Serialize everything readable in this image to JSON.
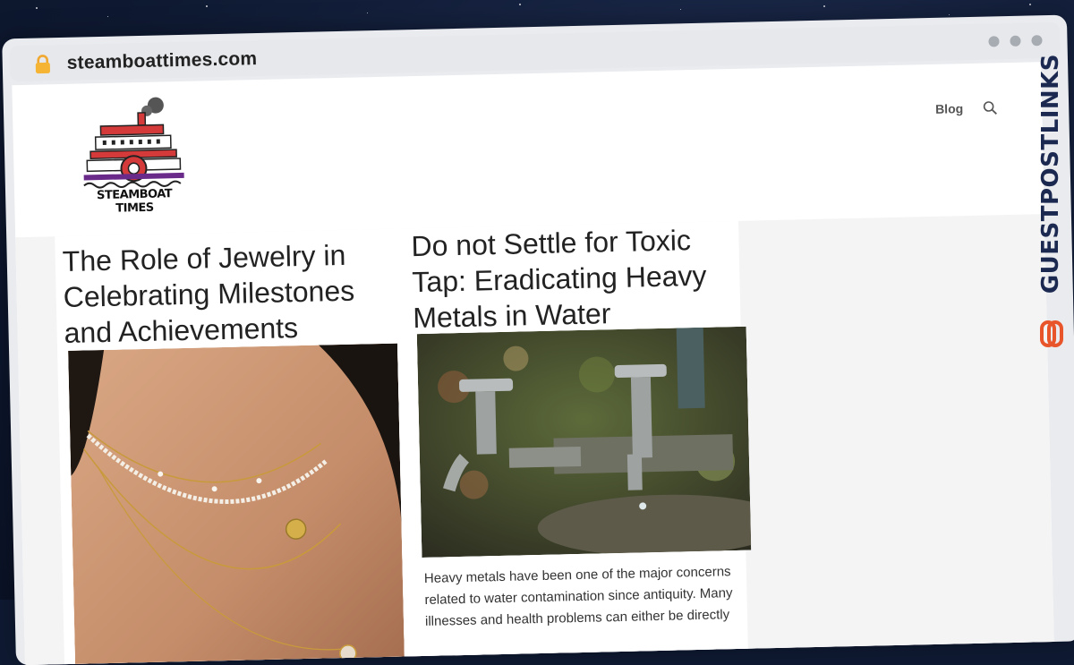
{
  "browser": {
    "url": "steamboattimes.com"
  },
  "site": {
    "logo_text": "STEAMBOAT TIMES",
    "nav": [
      {
        "label": "Blog"
      }
    ]
  },
  "posts": [
    {
      "title": "The Role of Jewelry in Celebrating Milestones and Achievements",
      "image": "necklace-photo"
    },
    {
      "title": "Do not Settle for Toxic Tap: Eradicating Heavy Metals in Water",
      "image": "water-tap-photo",
      "excerpt": "Heavy metals have been one of the major concerns related to water contamination since antiquity. Many illnesses and health problems can either be directly"
    }
  ],
  "watermark": {
    "text": "GUESTPOSTLINKS"
  },
  "colors": {
    "space": "#0f1a33",
    "brand": "#1b2850",
    "brand_accent": "#e8552b",
    "logo_red": "#d43a3a",
    "logo_purple": "#6a2a8a"
  }
}
